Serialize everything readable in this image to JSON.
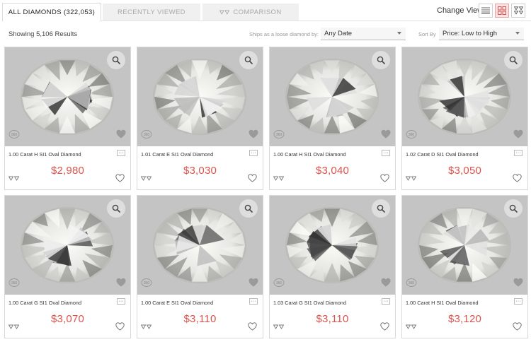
{
  "tabs": {
    "all_diamonds": "ALL DIAMONDS (322,053)",
    "recently_viewed": "RECENTLY VIEWED",
    "comparison": "COMPARISON"
  },
  "view": {
    "change_view_label": "Change View",
    "active": "grid"
  },
  "filters": {
    "results_text": "Showing 5,106 Results",
    "ships_label": "Ships as a loose diamond by:",
    "ships_value": "Any Date",
    "sort_label": "Sort By",
    "sort_value": "Price: Low to High"
  },
  "colors": {
    "price": "#d9534f",
    "active_view": "#fbe3e3",
    "photo_bg": "#c4c4c4"
  },
  "icons": [
    "list-view-icon",
    "grid-view-icon",
    "diamond-view-icon",
    "compare-icon",
    "zoom-icon",
    "360-icon",
    "heart-icon",
    "more-icon"
  ],
  "diamonds": [
    {
      "name": "1.00 Carat H SI1 Oval Diamond",
      "price": "$2,980"
    },
    {
      "name": "1.01 Carat E SI1 Oval Diamond",
      "price": "$3,030"
    },
    {
      "name": "1.00 Carat H SI1 Oval Diamond",
      "price": "$3,040"
    },
    {
      "name": "1.02 Carat D SI1 Oval Diamond",
      "price": "$3,050"
    },
    {
      "name": "1.00 Carat G SI1 Oval Diamond",
      "price": "$3,070"
    },
    {
      "name": "1.00 Carat E SI1 Oval Diamond",
      "price": "$3,110"
    },
    {
      "name": "1.03 Carat G SI1 Oval Diamond",
      "price": "$3,110"
    },
    {
      "name": "1.00 Carat H SI1 Oval Diamond",
      "price": "$3,120"
    }
  ]
}
